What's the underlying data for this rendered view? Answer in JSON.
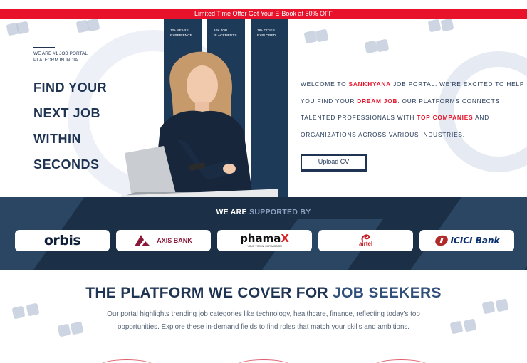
{
  "promo": {
    "text": "Limited Time Offer Get Your E-Book at 50% OFF"
  },
  "hero": {
    "kicker": "WE ARE #1 JOB PORTAL PLATFORM IN INDIA",
    "title_lines": [
      "FIND YOUR",
      "NEXT JOB",
      "WITHIN",
      "SECONDS"
    ],
    "stats": [
      {
        "line1": "10+ YEARS",
        "line2": "EXPERIENCE"
      },
      {
        "line1": "10K JOB",
        "line2": "PLACEMENTS"
      },
      {
        "line1": "18+ CITIES",
        "line2": "EXPLORED"
      }
    ],
    "welcome": {
      "part1": "WELCOME TO ",
      "brand": "SANKHYANA",
      "part2": " JOB PORTAL. WE'RE EXCITED TO HELP YOU FIND YOUR ",
      "dream": "DREAM JOB",
      "part3": ". OUR PLATFORMS CONNECTS TALENTED PROFESSIONALS WITH ",
      "top": "TOP COMPANIES",
      "part4": " AND ORGANIZATIONS ACROSS VARIOUS INDUSTRIES."
    },
    "upload_label": "Upload CV"
  },
  "supported": {
    "title_a": "WE ARE ",
    "title_b": "SUPPORTED BY",
    "logos": {
      "orbis": "orbis",
      "axis": "AXIS BANK",
      "phamax": "phama",
      "phamax_x": "X",
      "phamax_tagline": "YOUR VISION, OUR MISSION",
      "airtel": "airtel",
      "icici": "ICICI Bank"
    }
  },
  "platform": {
    "title_a": "THE PLATFORM WE COVER FOR ",
    "title_b": "JOB SEEKERS",
    "description": "Our portal highlights trending job categories like technology, healthcare,  finance, reflecting today's top opportunities. Explore these in-demand fields to find roles that match your skills and ambitions."
  },
  "colors": {
    "accent_red": "#e8132b",
    "navy": "#1f3452",
    "supported_bg": "#1b3047"
  }
}
